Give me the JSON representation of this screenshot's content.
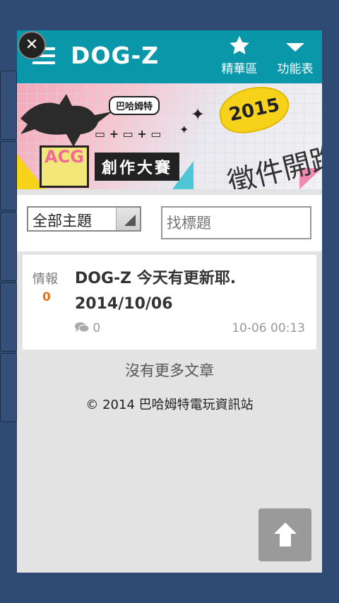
{
  "header": {
    "title": "DOG-Z",
    "featured_label": "精華區",
    "menu_label": "功能表",
    "color": "#0a97aa"
  },
  "banner": {
    "site_logo": "巴哈姆特",
    "year": "2015",
    "contest": "創作大賽",
    "call": "徵件開跑",
    "acg": "ACG"
  },
  "filter": {
    "topic_selected": "全部主題",
    "search_placeholder": "找標題"
  },
  "posts": [
    {
      "category": "情報",
      "gp_count": "0",
      "title": "DOG-Z 今天有更新耶. 2014/10/06",
      "comments": "0",
      "time": "10-06 00:13"
    }
  ],
  "footer": {
    "no_more": "沒有更多文章",
    "copyright": "© 2014 巴哈姆特電玩資訊站"
  },
  "icons": {
    "close": "close-icon",
    "menu": "hamburger-icon",
    "featured": "star-icon",
    "dropdown": "chevron-down-icon",
    "comment": "comment-icon",
    "to_top": "arrow-up-icon"
  }
}
